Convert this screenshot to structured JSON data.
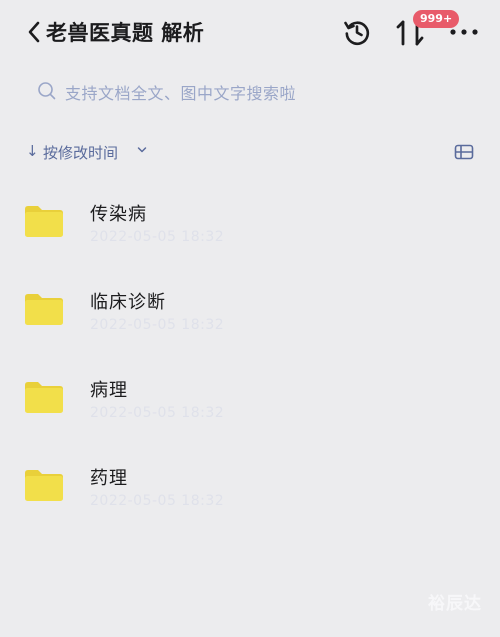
{
  "header": {
    "title": "老兽医真题 解析",
    "badge": "999+",
    "transfer_glyph": "1"
  },
  "search": {
    "placeholder": "支持文档全文、图中文字搜索啦"
  },
  "sort": {
    "arrow": "↓",
    "label": "按修改时间"
  },
  "items": [
    {
      "name": "传染病",
      "date": "2022-05-05 18:32"
    },
    {
      "name": "临床诊断",
      "date": "2022-05-05 18:32"
    },
    {
      "name": "病理",
      "date": "2022-05-05 18:32"
    },
    {
      "name": "药理",
      "date": "2022-05-05 18:32"
    }
  ],
  "watermark": "裕辰达",
  "colors": {
    "accent": "#5a6b9c",
    "badge": "#e85b6a",
    "folder": "#f2df4a",
    "background": "#ececee"
  },
  "icons": [
    "back-icon",
    "history-icon",
    "transfer-icon",
    "more-icon",
    "search-icon",
    "chevron-down-icon",
    "view-toggle-icon",
    "folder-icon"
  ]
}
